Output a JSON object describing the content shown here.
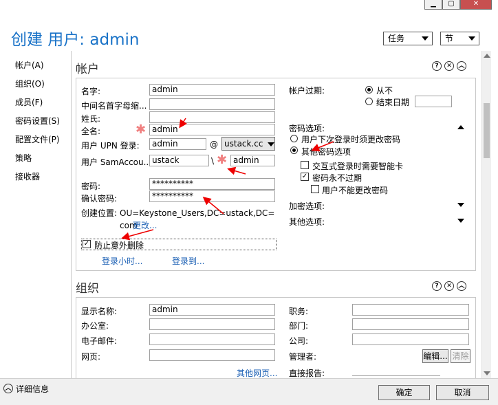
{
  "window": {
    "min_icon": "minimize-icon",
    "max_icon": "maximize-icon",
    "close_icon": "close-icon",
    "min_glyph": "▁",
    "max_glyph": "▢",
    "close_glyph": "✕"
  },
  "header": {
    "title": "创建 用户: admin",
    "tasks_dropdown": "任务",
    "sections_dropdown": "节"
  },
  "sidebar": {
    "items": [
      "帐户(A)",
      "组织(O)",
      "成员(F)",
      "密码设置(S)",
      "配置文件(P)",
      "策略",
      "接收器"
    ]
  },
  "account": {
    "title": "帐户",
    "labels": {
      "first_name": "名字:",
      "initials": "中间名首字母缩...",
      "last_name": "姓氏:",
      "full_name": "全名:",
      "upn": "用户 UPN 登录:",
      "sam": "用户 SamAccou...",
      "password": "密码:",
      "confirm_password": "确认密码:",
      "create_in": "创建位置:",
      "expire": "帐户过期:",
      "pwd_options": "密码选项:",
      "enc_options": "加密选项:",
      "other_options": "其他选项:"
    },
    "values": {
      "first_name": "admin",
      "initials": "",
      "last_name": "",
      "full_name": "admin",
      "upn_user": "admin",
      "upn_at": "@",
      "upn_domain": "ustack.cc",
      "sam_domain": "ustack",
      "sam_sep": "\\",
      "sam_user": "admin",
      "password": "**********",
      "confirm_password": "**********",
      "create_in": "OU=Keystone_Users,DC=ustack,DC=com",
      "change_link": "更改..."
    },
    "protect_label": "防止意外删除",
    "logon_hours_link": "登录小时...",
    "logon_to_link": "登录到...",
    "expire_never": "从不",
    "expire_date": "结束日期",
    "pwd_must_change": "用户下次登录时须更改密码",
    "pwd_other": "其他密码选项",
    "smartcard": "交互式登录时需要智能卡",
    "never_expires": "密码永不过期",
    "cannot_change": "用户不能更改密码"
  },
  "organization": {
    "title": "组织",
    "labels": {
      "display_name": "显示名称:",
      "office": "办公室:",
      "email": "电子邮件:",
      "web": "网页:",
      "job_title": "职务:",
      "department": "部门:",
      "company": "公司:",
      "manager": "管理者:",
      "direct_reports": "直接报告:"
    },
    "values": {
      "display_name": "admin"
    },
    "other_web_link": "其他网页...",
    "edit_button": "编辑...",
    "clear_button": "清除"
  },
  "footer": {
    "details": "详细信息",
    "ok": "确定",
    "cancel": "取消"
  },
  "icons": {
    "help": "?",
    "close": "✕",
    "collapse": "︿",
    "required_star": "✱",
    "check": "✓"
  }
}
